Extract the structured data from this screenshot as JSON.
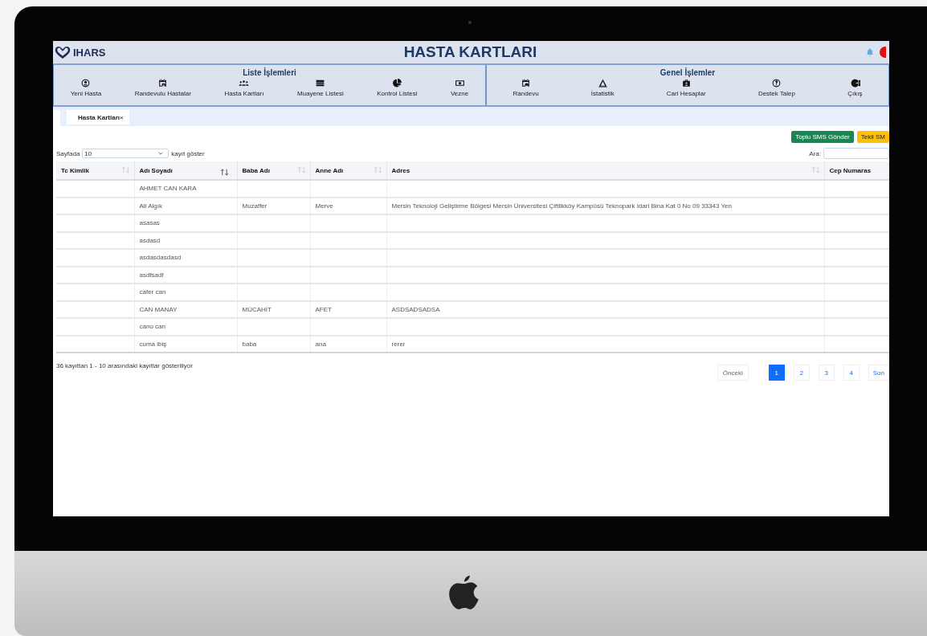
{
  "app": {
    "logo": "IHARS",
    "title": "HASTA KARTLARI"
  },
  "menu_groups": [
    {
      "title": "Liste İşlemleri",
      "items": [
        {
          "label": "Yeni Hasta"
        },
        {
          "label": "Randevulu Hastalar"
        },
        {
          "label": "Hasta Kartları"
        },
        {
          "label": "Muayene Listesi"
        },
        {
          "label": "Kontrol Listesi"
        },
        {
          "label": "Vezne"
        }
      ]
    },
    {
      "title": "Genel İşlemler",
      "items": [
        {
          "label": "Randevu"
        },
        {
          "label": "İstatistik"
        },
        {
          "label": "Cari Hesaplar"
        },
        {
          "label": "Destek Talep"
        },
        {
          "label": "Çıkış"
        }
      ]
    }
  ],
  "tabs": [
    {
      "label": "Hasta Kartları",
      "close": "×",
      "selected": true
    }
  ],
  "actions": [
    {
      "label": "Toplu SMS Gönder",
      "color": "#198754"
    },
    {
      "label": "Tekli SM",
      "color": "#ffc107"
    }
  ],
  "page_size": {
    "prefix": "Sayfada",
    "value": "10",
    "suffix": "kayıt göster"
  },
  "search": {
    "label": "Ara:"
  },
  "table": {
    "columns": [
      {
        "label": "Tc Kimlik",
        "sorted": false
      },
      {
        "label": "Adı Soyadı",
        "sorted": true
      },
      {
        "label": "Baba Adı",
        "sorted": false
      },
      {
        "label": "Anne Adı",
        "sorted": false
      },
      {
        "label": "Adres",
        "sorted": false
      },
      {
        "label": "Cep Numaras"
      }
    ],
    "rows": [
      {
        "name": "AHMET CAN KARA"
      },
      {
        "name": "Ali Algık",
        "father": "Muzaffer",
        "mother": "Merve",
        "address": "Mersin Teknoloji Geliştirme Bölgesi Mersin Üniversitesi Çiftlikköy Kampüsü Teknopark İdari Bina Kat 0 No 09 33343 Yen"
      },
      {
        "name": "asasas"
      },
      {
        "name": "asdasd"
      },
      {
        "name": "asdasdasdasd"
      },
      {
        "name": "asdfsadf"
      },
      {
        "name": "cafer can"
      },
      {
        "name": "CAN MANAY",
        "father": "MÜCAHİT",
        "mother": "AFET",
        "address": "ASDSADSADSA"
      },
      {
        "name": "cano can"
      },
      {
        "name": "cuma ibiş",
        "father": "baba",
        "mother": "ana",
        "address": "rerer"
      }
    ]
  },
  "info": "36 kayıttan 1 - 10 arasındaki kayıtlar gösteriliyor",
  "pagination": [
    {
      "label": "Önceki",
      "selected": false
    },
    {
      "label": "1",
      "selected": true
    },
    {
      "label": "2",
      "selected": false
    },
    {
      "label": "3",
      "selected": false
    },
    {
      "label": "4",
      "selected": false
    },
    {
      "label": "Son",
      "selected": false
    }
  ]
}
